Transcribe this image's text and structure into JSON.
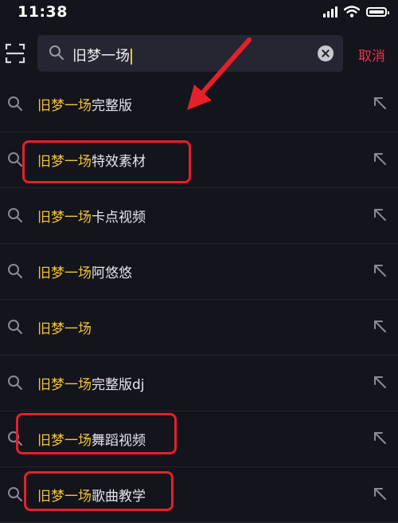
{
  "status_bar": {
    "time": "11:38",
    "icons": [
      "signal-icon",
      "wifi-icon",
      "battery-icon"
    ]
  },
  "search": {
    "value": "旧梦一场",
    "scan_icon": "scan-icon",
    "search_icon": "search-icon",
    "clear_icon": "clear-icon",
    "cancel_label": "取消"
  },
  "suggestions": [
    {
      "highlight": "旧梦一场",
      "rest": "完整版"
    },
    {
      "highlight": "旧梦一场",
      "rest": "特效素材"
    },
    {
      "highlight": "旧梦一场",
      "rest": "卡点视频"
    },
    {
      "highlight": "旧梦一场",
      "rest": "阿悠悠"
    },
    {
      "highlight": "旧梦一场",
      "rest": ""
    },
    {
      "highlight": "旧梦一场",
      "rest": "完整版dj"
    },
    {
      "highlight": "旧梦一场",
      "rest": "舞蹈视频"
    },
    {
      "highlight": "旧梦一场",
      "rest": "歌曲教学"
    }
  ],
  "colors": {
    "background": "#14141c",
    "search_box": "#262633",
    "highlight": "#f3c33b",
    "cancel": "#e8334a",
    "annotation": "#e5202a"
  }
}
